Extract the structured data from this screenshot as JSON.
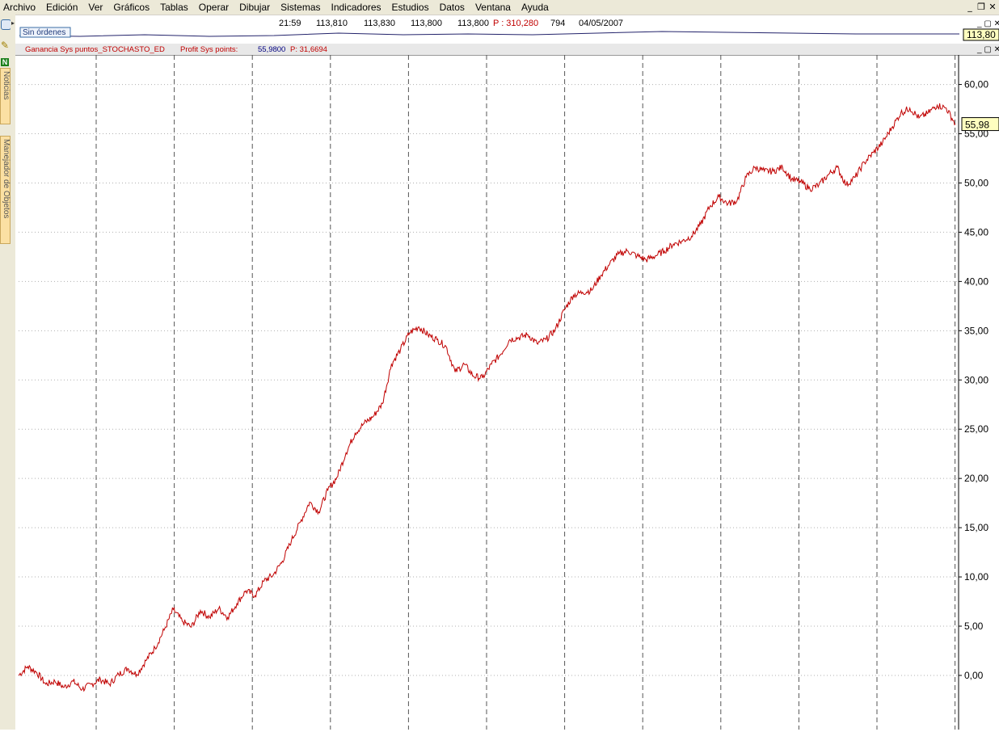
{
  "menu": [
    {
      "label": "Archivo"
    },
    {
      "label": "Edición"
    },
    {
      "label": "Ver"
    },
    {
      "label": "Gráficos"
    },
    {
      "label": "Tablas"
    },
    {
      "label": "Operar"
    },
    {
      "label": "Dibujar"
    },
    {
      "label": "Sistemas"
    },
    {
      "label": "Indicadores"
    },
    {
      "label": "Estudios"
    },
    {
      "label": "Datos"
    },
    {
      "label": "Ventana"
    },
    {
      "label": "Ayuda"
    }
  ],
  "side_tabs": {
    "news": "Noticias",
    "objects": "Manejador de Objetos",
    "n_badge": "N"
  },
  "quote": {
    "time": "21:59",
    "open": "113,810",
    "high": "113,830",
    "low": "113,800",
    "close": "113,800",
    "p_label": "P : 310,280",
    "volume": "794",
    "date": "04/05/2007",
    "badge": "Sin órdenes",
    "price_marker": "113,80"
  },
  "panel": {
    "name": "Ganancia Sys puntos_STOCHASTO_ED",
    "metric_label": "Profit Sys points:",
    "metric_value": "55,9800",
    "p_value": "P: 31,6694",
    "last_value": "55,98"
  },
  "colors": {
    "line": "#c00000",
    "panel_title": "#c00000",
    "metric_value": "#000080",
    "grid": "#b0b0b0"
  },
  "chart_data": {
    "type": "line",
    "title": "Ganancia Sys puntos_STOCHASTO_ED",
    "xlabel": "",
    "ylabel": "",
    "ylim": [
      -5.5,
      63
    ],
    "y_ticks": [
      0,
      5,
      10,
      15,
      20,
      25,
      30,
      35,
      40,
      45,
      50,
      55,
      60
    ],
    "y_tick_labels": [
      "0,00",
      "5,00",
      "10,00",
      "15,00",
      "20,00",
      "25,00",
      "30,00",
      "35,00",
      "40,00",
      "45,00",
      "50,00",
      "55,00",
      "60,00"
    ],
    "grid": true,
    "series": [
      {
        "values": [
          0.0,
          0.9,
          0.3,
          -0.9,
          -0.6,
          -1.2,
          -0.6,
          -1.4,
          -0.9,
          -0.4,
          -0.9,
          0.1,
          0.7,
          0.1,
          1.5,
          2.8,
          4.6,
          6.7,
          5.5,
          4.9,
          6.6,
          5.9,
          6.8,
          5.9,
          7.3,
          8.6,
          8.1,
          9.6,
          10.2,
          11.6,
          13.7,
          15.6,
          17.6,
          16.6,
          18.8,
          20.1,
          22.6,
          24.6,
          25.6,
          26.3,
          27.6,
          31.6,
          33.1,
          34.8,
          35.4,
          34.6,
          34.1,
          33.4,
          30.8,
          31.6,
          30.4,
          30.2,
          31.6,
          32.6,
          34.1,
          34.3,
          34.6,
          33.7,
          34.1,
          35.1,
          37.1,
          38.6,
          38.9,
          39.1,
          40.6,
          41.8,
          42.8,
          43.1,
          42.6,
          42.2,
          42.6,
          43.1,
          43.8,
          44.1,
          44.6,
          45.8,
          47.6,
          48.6,
          47.9,
          48.2,
          50.6,
          51.6,
          51.2,
          51.2,
          51.6,
          50.4,
          50.1,
          49.4,
          49.8,
          50.8,
          51.6,
          49.8,
          50.6,
          52.1,
          53.1,
          54.1,
          55.6,
          57.1,
          57.6,
          56.6,
          57.1,
          57.9,
          57.6,
          55.98
        ]
      }
    ]
  }
}
